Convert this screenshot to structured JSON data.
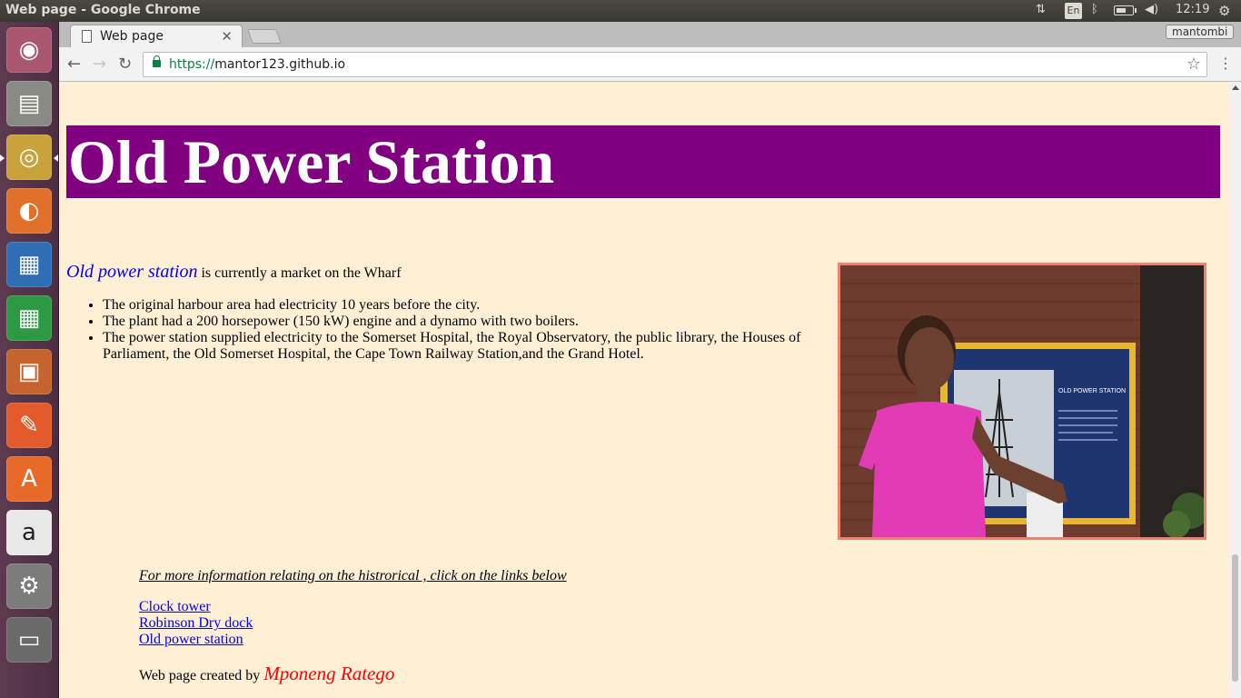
{
  "system": {
    "window_title": "Web page - Google Chrome",
    "keyboard_layout": "En",
    "clock": "12:19",
    "battery_level_pct": 60
  },
  "launcher": {
    "items": [
      {
        "name": "ubuntu-dash-icon",
        "glyph": "◉",
        "bg": "#a9566e"
      },
      {
        "name": "files-icon",
        "glyph": "▤",
        "bg": "#8a8a85"
      },
      {
        "name": "chrome-icon",
        "glyph": "◎",
        "bg": "#c9a23b",
        "active": true
      },
      {
        "name": "firefox-icon",
        "glyph": "◐",
        "bg": "#e0702a"
      },
      {
        "name": "writer-icon",
        "glyph": "▦",
        "bg": "#2f6db5"
      },
      {
        "name": "calc-icon",
        "glyph": "▦",
        "bg": "#2d9a43"
      },
      {
        "name": "impress-icon",
        "glyph": "▣",
        "bg": "#c6642d"
      },
      {
        "name": "pencil-app-icon",
        "glyph": "✎",
        "bg": "#e35a2a"
      },
      {
        "name": "software-center-icon",
        "glyph": "A",
        "bg": "#e86a2b"
      },
      {
        "name": "amazon-icon",
        "glyph": "a",
        "bg": "#e8e8e8"
      },
      {
        "name": "system-settings-icon",
        "glyph": "⚙",
        "bg": "#7c7c7c"
      },
      {
        "name": "workspaces-icon",
        "glyph": "▭",
        "bg": "#6a6a6a"
      }
    ]
  },
  "browser": {
    "tab_title": "Web page",
    "profile_name": "mantombi",
    "url_scheme": "https://",
    "url_host": "mantor123.github.io"
  },
  "page": {
    "heading": "Old Power Station",
    "intro_emphasis": "Old power station",
    "intro_rest": " is currently a market on the Wharf",
    "facts": [
      "The original harbour area had electricity 10 years before the city.",
      "The plant had a 200 horsepower (150 kW) engine and a dynamo with two boilers.",
      "The power station supplied electricity to the Somerset Hospital, the Royal Observatory, the public library, the Houses of Parliament, the Old Somerset Hospital, the Cape Town Railway Station,and the Grand Hotel."
    ],
    "photo_sign_title": "OLD POWER STATION",
    "more_info": "For more information relating on the histrorical , click on the links below",
    "links": [
      "Clock tower ",
      "Robinson Dry dock ",
      "Old power station"
    ],
    "credit_prefix": "Web page created by ",
    "credit_author": "Mponeng Ratego"
  }
}
